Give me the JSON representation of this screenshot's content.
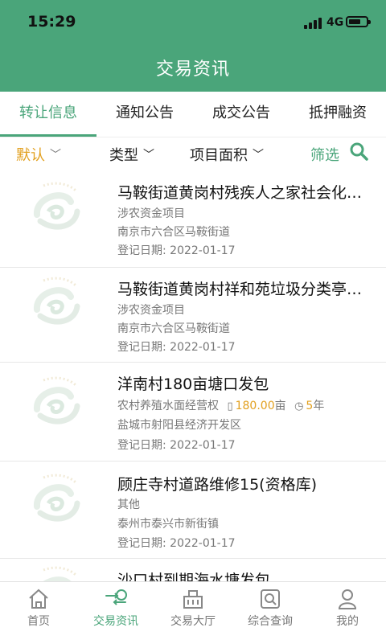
{
  "status_bar": {
    "time": "15:29",
    "network": "4G"
  },
  "header": {
    "title": "交易资讯"
  },
  "tabs": [
    {
      "label": "转让信息",
      "active": true
    },
    {
      "label": "通知公告",
      "active": false
    },
    {
      "label": "成交公告",
      "active": false
    },
    {
      "label": "抵押融资",
      "active": false
    }
  ],
  "filters": {
    "default": "默认",
    "type": "类型",
    "area": "项目面积",
    "filter": "筛选"
  },
  "items": [
    {
      "title": "马鞍街道黄岗村残疾人之家社会化…",
      "category": "涉农资金项目",
      "location": "南京市六合区马鞍街道",
      "date": "登记日期: 2022-01-17"
    },
    {
      "title": "马鞍街道黄岗村祥和苑垃圾分类亭…",
      "category": "涉农资金项目",
      "location": "南京市六合区马鞍街道",
      "date": "登记日期: 2022-01-17"
    },
    {
      "title": "洋南村180亩塘口发包",
      "category": "农村养殖水面经营权",
      "area_value": "180.00",
      "area_unit": "亩",
      "term_value": "5",
      "term_unit": "年",
      "location": "盐城市射阳县经济开发区",
      "date": "登记日期: 2022-01-17"
    },
    {
      "title": "顾庄寺村道路维修15(资格库)",
      "category": "其他",
      "location": "泰州市泰兴市新街镇",
      "date": "登记日期: 2022-01-17"
    },
    {
      "title": "沙口村到期海水塘发包"
    }
  ],
  "tabbar": [
    {
      "label": "首页",
      "icon": "home-icon",
      "active": false
    },
    {
      "label": "交易资讯",
      "icon": "news-icon",
      "active": true
    },
    {
      "label": "交易大厅",
      "icon": "building-icon",
      "active": false
    },
    {
      "label": "综合查询",
      "icon": "query-icon",
      "active": false
    },
    {
      "label": "我的",
      "icon": "user-icon",
      "active": false
    }
  ],
  "colors": {
    "brand": "#4aa57a",
    "highlight": "#e2a01f"
  }
}
